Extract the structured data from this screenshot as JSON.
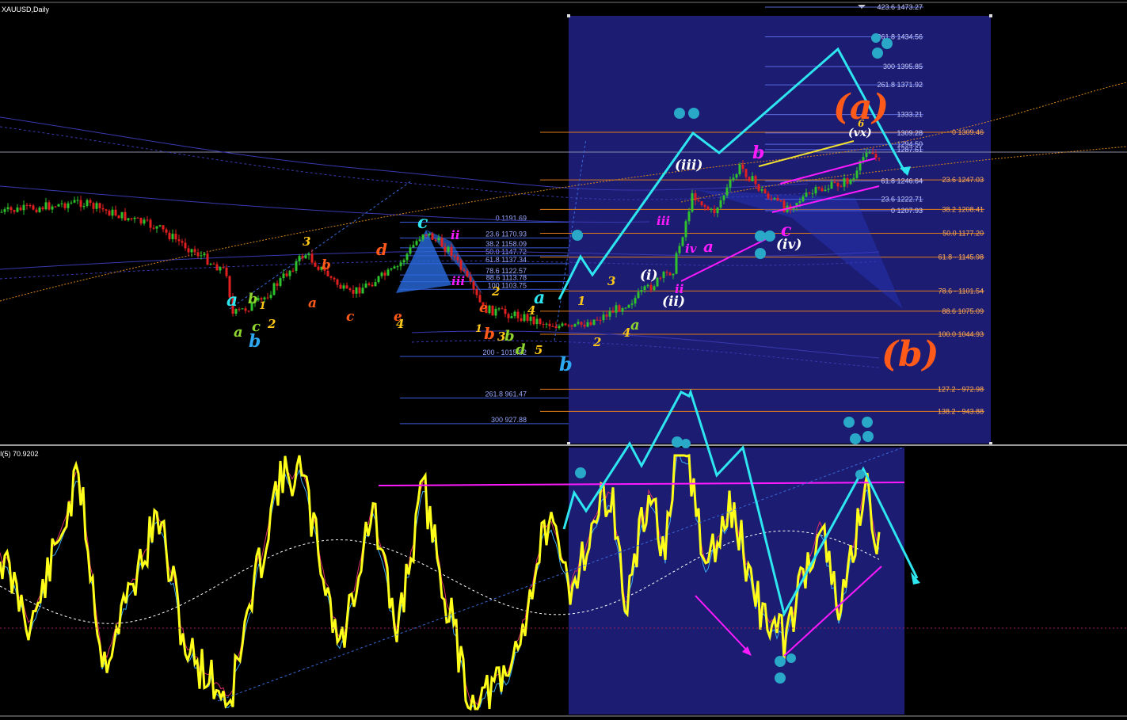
{
  "chart_data": {
    "type": "candlestick",
    "symbol_label": "XAUUSD,Daily",
    "indicator_label": "I(5) 70.9202",
    "colors": {
      "background": "#000000",
      "highlight_box": "#1c1c73",
      "candle_up": "#2ec22e",
      "candle_down": "#e02020",
      "wave_primary": "#2ee6f0",
      "oscillator": "#ffff1a",
      "magenta": "#ff1aff",
      "fib_line": "#e07d1a",
      "big_label": "#ff5a1a"
    },
    "left_fib_levels": [
      {
        "label": "0 1191.69",
        "value": 1191.69
      },
      {
        "label": "23.6 1170.93",
        "value": 1170.93
      },
      {
        "label": "38.2 1158.09",
        "value": 1158.09
      },
      {
        "label": "50.0 1147.72",
        "value": 1147.72
      },
      {
        "label": "61.8 1137.34",
        "value": 1137.34
      },
      {
        "label": "78.6 1122.57",
        "value": 1122.57
      },
      {
        "label": "88.6 1113.78",
        "value": 1113.78
      },
      {
        "label": "100 1103.75",
        "value": 1103.75
      },
      {
        "label": "200 - 1015.82",
        "value": 1015.82
      },
      {
        "label": "261.8 961.47",
        "value": 961.47
      },
      {
        "label": "300 927.88",
        "value": 927.88
      }
    ],
    "right_fib_levels": [
      {
        "label": "0 1309.46",
        "value": 1309.46
      },
      {
        "label": "23.6 1247.03",
        "value": 1247.03
      },
      {
        "label": "38.2 1208.41",
        "value": 1208.41
      },
      {
        "label": "50.0 1177.20",
        "value": 1177.2
      },
      {
        "label": "61.8 - 1145.98",
        "value": 1145.98
      },
      {
        "label": "78.6 - 1101.54",
        "value": 1101.54
      },
      {
        "label": "88.6 1075.09",
        "value": 1075.09
      },
      {
        "label": "100.0 1044.93",
        "value": 1044.93
      },
      {
        "label": "127.2 - 972.98",
        "value": 972.98
      },
      {
        "label": "138.2 - 943.88",
        "value": 943.88
      }
    ],
    "box_fib_levels": [
      {
        "label": "423.6 1473.27",
        "value": 1473.27
      },
      {
        "label": "361.8 1434.56",
        "value": 1434.56
      },
      {
        "label": "300 1395.85",
        "value": 1395.85
      },
      {
        "label": "261.8 1371.92",
        "value": 1371.92
      },
      {
        "label": "1333.21",
        "value": 1333.21
      },
      {
        "label": "1309.28",
        "value": 1309.28
      },
      {
        "label": "1294.50",
        "value": 1294.5
      },
      {
        "label": "1287.61",
        "value": 1287.61
      },
      {
        "label": "61.8 1246.64",
        "value": 1246.64
      },
      {
        "label": "23.6 1222.71",
        "value": 1222.71
      },
      {
        "label": "0 1207.93",
        "value": 1207.93
      }
    ],
    "wave_labels": [
      {
        "text": "(a)",
        "big": true
      },
      {
        "text": "(b)",
        "big": true
      },
      {
        "text": "(iii)"
      },
      {
        "text": "(iv)"
      },
      {
        "text": "(i)"
      },
      {
        "text": "(ii)"
      },
      {
        "text": "(vx)"
      },
      {
        "text": "b"
      },
      {
        "text": "c"
      },
      {
        "text": "a"
      },
      {
        "text": "iii"
      },
      {
        "text": "iv"
      },
      {
        "text": "ii"
      },
      {
        "text": "d"
      },
      {
        "text": "e"
      },
      {
        "text": "1"
      },
      {
        "text": "2"
      },
      {
        "text": "3"
      },
      {
        "text": "4"
      },
      {
        "text": "5"
      },
      {
        "text": "6"
      }
    ]
  }
}
